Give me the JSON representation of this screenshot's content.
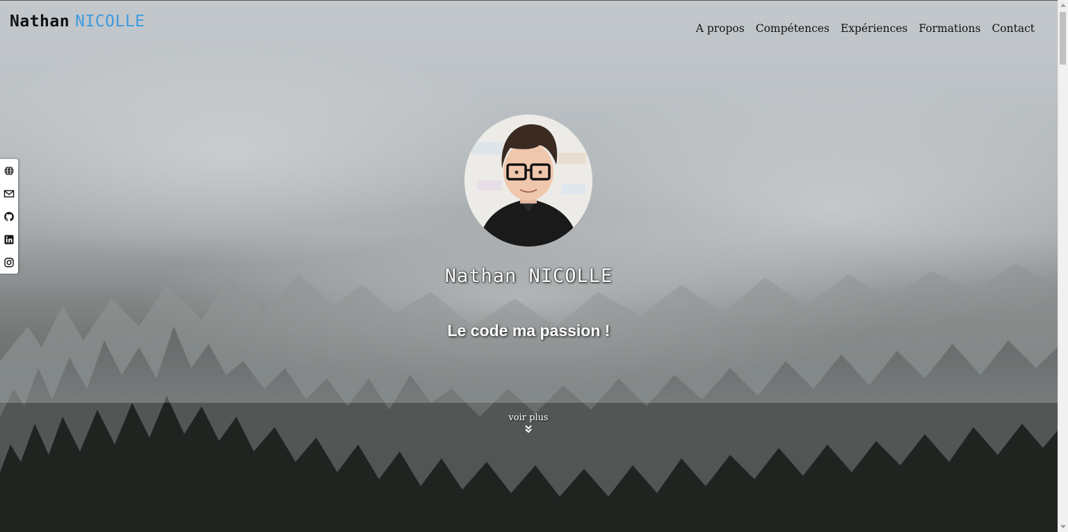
{
  "header": {
    "brand_first": "Nathan",
    "brand_last": "NICOLLE",
    "brand_accent_color": "#3d9be0"
  },
  "nav": {
    "items": [
      {
        "label": "A propos"
      },
      {
        "label": "Compétences"
      },
      {
        "label": "Expériences"
      },
      {
        "label": "Formations"
      },
      {
        "label": "Contact"
      }
    ]
  },
  "social": {
    "icons": [
      "globe-icon",
      "envelope-icon",
      "github-icon",
      "linkedin-icon",
      "instagram-icon"
    ]
  },
  "hero": {
    "name": "Nathan NICOLLE",
    "tagline": "Le code ma passion !",
    "more_label": "voir plus",
    "more_icon": "double-chevron-down-icon"
  }
}
